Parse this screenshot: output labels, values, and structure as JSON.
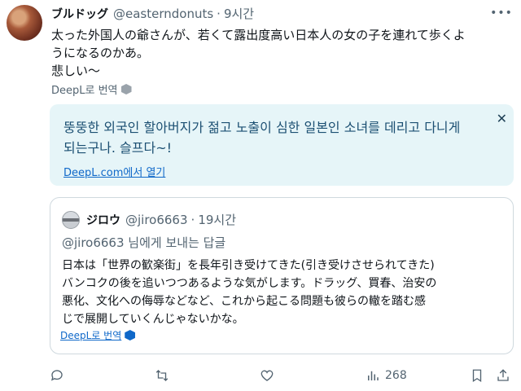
{
  "post": {
    "author_name": "ブルドッグ",
    "author_handle": "@easterndonuts",
    "separator": "·",
    "time": "9시간",
    "text_lines": [
      "太った外国人の爺さんが、若くて露出度高い日本人の女の子を連れて歩くよ",
      "うになるのかあ。",
      "悲しい〜"
    ],
    "translate_link": "DeepL로 번역"
  },
  "translation": {
    "text_lines": [
      "뚱뚱한 외국인 할아버지가 젊고 노출이 심한 일본인 소녀를 데리고 다니게",
      "되는구나. 슬프다~!"
    ],
    "open_link": "DeepL.com에서 열기",
    "close_symbol": "✕"
  },
  "quote": {
    "author_name": "ジロウ",
    "author_handle": "@jiro6663",
    "separator": "·",
    "time": "19시간",
    "reply_to": "@jiro6663 님에게 보내는 답글",
    "text_lines": [
      "日本は「世界の歓楽街」を長年引き受けてきた(引き受けさせられてきた)",
      "バンコクの後を追いつつあるような気がします。ドラッグ、買春、治安の",
      "悪化、文化への侮辱などなど、これから起こる問題も彼らの轍を踏む感",
      "じで展開していくんじゃないかな。"
    ],
    "translate_link": "DeepL로 번역"
  },
  "actions": {
    "views_count": "268"
  },
  "icons": {
    "more": "more-horizontal-icon",
    "reply": "reply-icon",
    "repost": "repost-icon",
    "like": "heart-icon",
    "views": "analytics-icon",
    "bookmark": "bookmark-icon",
    "share": "share-icon",
    "deepl": "deepl-icon",
    "close": "close-icon"
  },
  "colors": {
    "text": "#0f1419",
    "secondary": "#536471",
    "link_blue": "#0f68c9",
    "translation_bg": "#e6f5f8",
    "translation_text": "#1b4f72",
    "border": "#cfd9de"
  }
}
